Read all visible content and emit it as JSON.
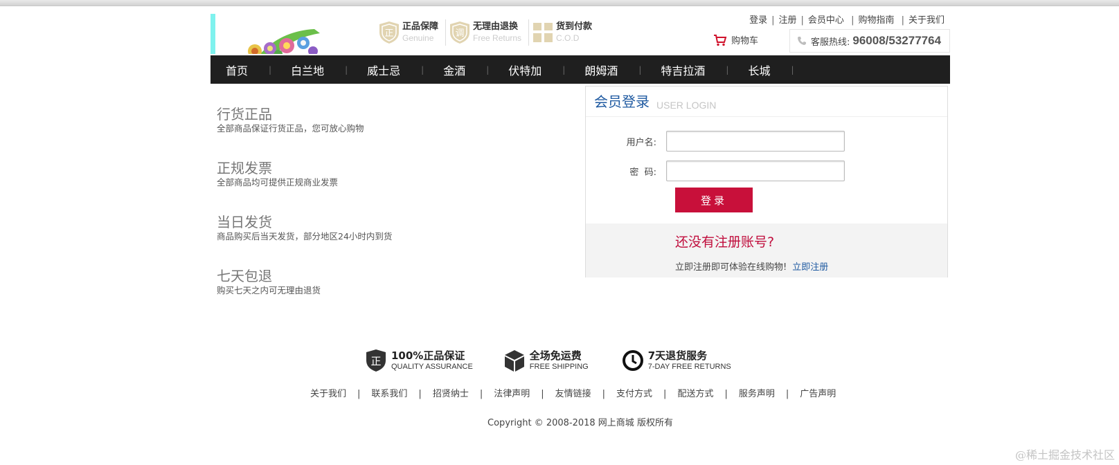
{
  "header": {
    "promos": [
      {
        "title": "正品保障",
        "sub": "Genuine",
        "icon": "shield-zheng-icon"
      },
      {
        "title": "无理由退换",
        "sub": "Free Returns",
        "icon": "shield-tiao-icon"
      },
      {
        "title": "货到付款",
        "sub": "C.O.D",
        "icon": "gift-box-icon"
      }
    ],
    "toplinks": [
      "登录",
      "注册",
      "会员中心",
      "购物指南",
      "关于我们"
    ],
    "cart_label": "购物车",
    "hotline_label": "客服热线:",
    "hotline_number": "96008/53277764"
  },
  "nav": {
    "items": [
      "首页",
      "白兰地",
      "威士忌",
      "金酒",
      "伏特加",
      "朗姆酒",
      "特吉拉酒",
      "长城"
    ]
  },
  "features": [
    {
      "title": "行货正品",
      "desc": "全部商品保证行货正品，您可放心购物"
    },
    {
      "title": "正规发票",
      "desc": "全部商品均可提供正规商业发票"
    },
    {
      "title": "当日发货",
      "desc": "商品购买后当天发货，部分地区24小时内到货"
    },
    {
      "title": "七天包退",
      "desc": "购买七天之内可无理由退货"
    }
  ],
  "login": {
    "title": "会员登录",
    "subtitle": "USER LOGIN",
    "username_label": "用户名:",
    "username_value": "",
    "password_label": "密  码:",
    "password_value": "",
    "submit_label": "登录",
    "no_account": "还没有注册账号?",
    "register_hint": "立即注册即可体验在线购物!",
    "register_link": "立即注册"
  },
  "footer": {
    "guarantees": [
      {
        "title": "100%正品保证",
        "sub": "QUALITY ASSURANCE",
        "icon": "shield-zheng-icon"
      },
      {
        "title": "全场免运费",
        "sub": "FREE SHIPPING",
        "icon": "box-icon"
      },
      {
        "title": "7天退货服务",
        "sub": "7-DAY FREE RETURNS",
        "icon": "clock-icon"
      }
    ],
    "links": [
      "关于我们",
      "联系我们",
      "招贤纳士",
      "法律声明",
      "友情链接",
      "支付方式",
      "配送方式",
      "服务声明",
      "广告声明"
    ],
    "copyright": "Copyright © 2008-2018 网上商城 版权所有"
  },
  "watermark": "@稀土掘金技术社区",
  "colors": {
    "nav_bg": "#1f1f1f",
    "login_button": "#c8103a",
    "accent_blue": "#1f5aa1",
    "accent_red": "#c00d3c"
  }
}
